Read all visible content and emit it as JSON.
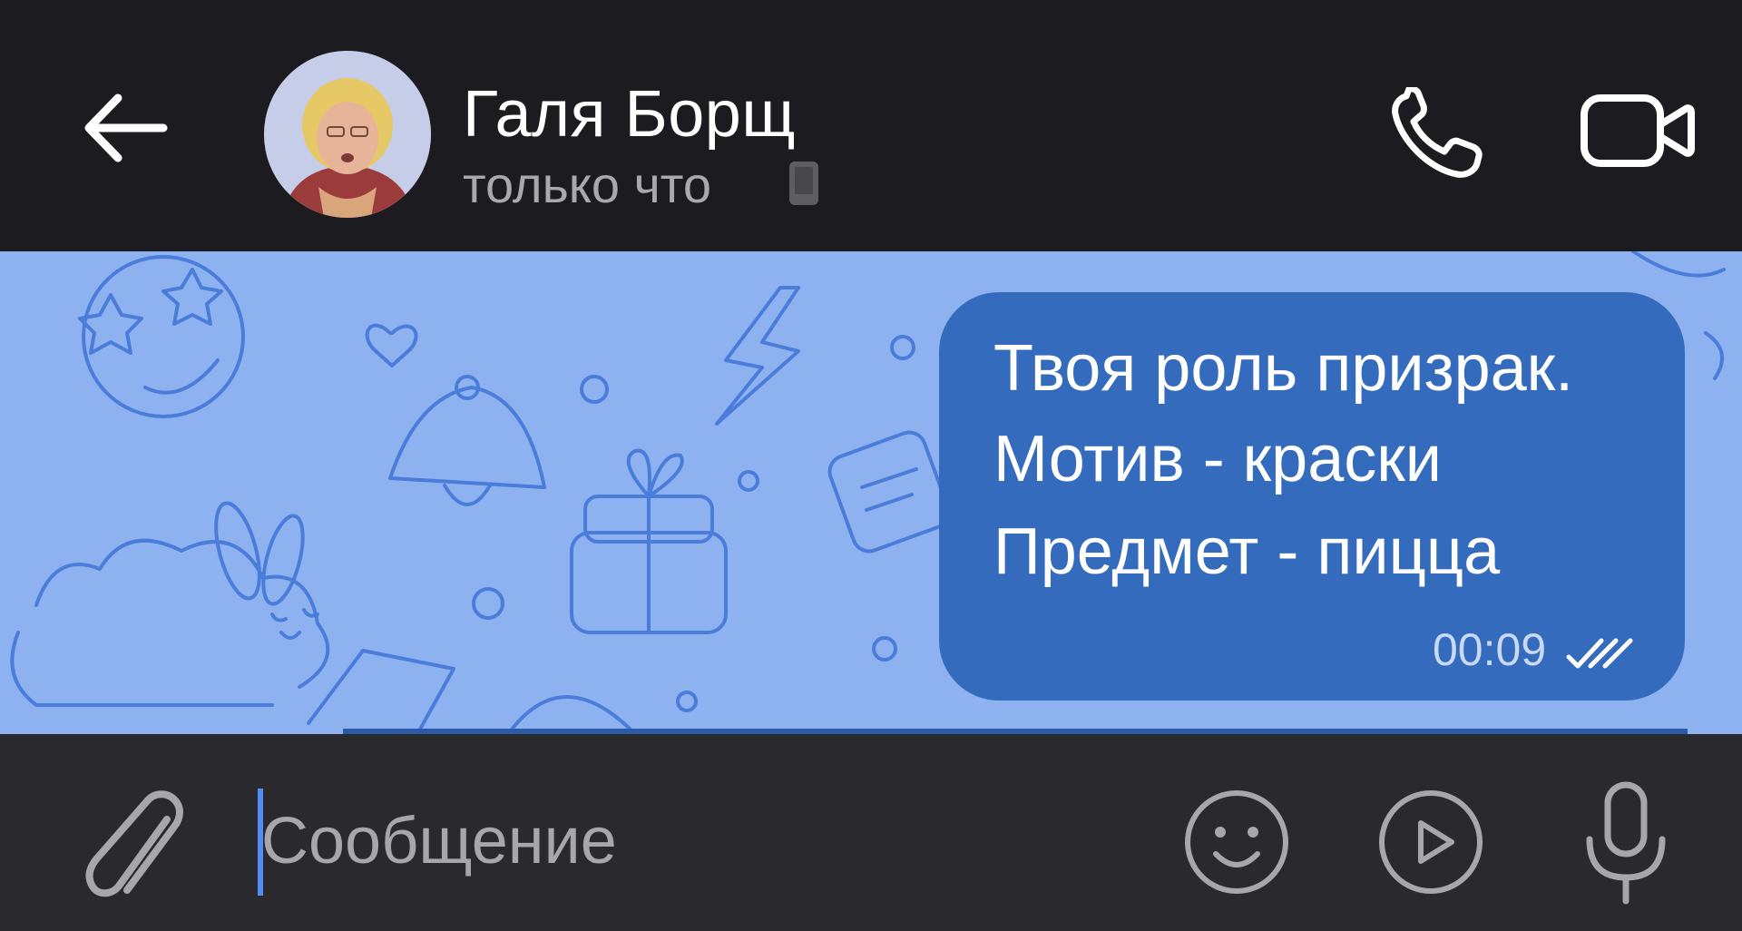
{
  "header": {
    "contact_name": "Галя Борщ",
    "status": "только что",
    "icons": {
      "back": "arrow-left-icon",
      "device": "phone-device-icon",
      "call": "phone-icon",
      "video": "video-camera-icon"
    }
  },
  "chat": {
    "messages": [
      {
        "direction": "outgoing",
        "lines": [
          "Твоя роль призрак.",
          "Мотив - краски",
          "Предмет - пицца"
        ],
        "time": "00:09",
        "status": "read"
      }
    ]
  },
  "input_bar": {
    "placeholder": "Сообщение",
    "value": "",
    "icons": {
      "attach": "paperclip-icon",
      "emoji": "smile-icon",
      "video_message": "play-circle-icon",
      "voice": "microphone-icon"
    }
  },
  "colors": {
    "header_bg": "#1c1b1f",
    "chat_bg": "#8eb2f0",
    "bubble_bg": "#356bbd",
    "input_bg": "#2a292e",
    "accent": "#4f8ff7"
  }
}
